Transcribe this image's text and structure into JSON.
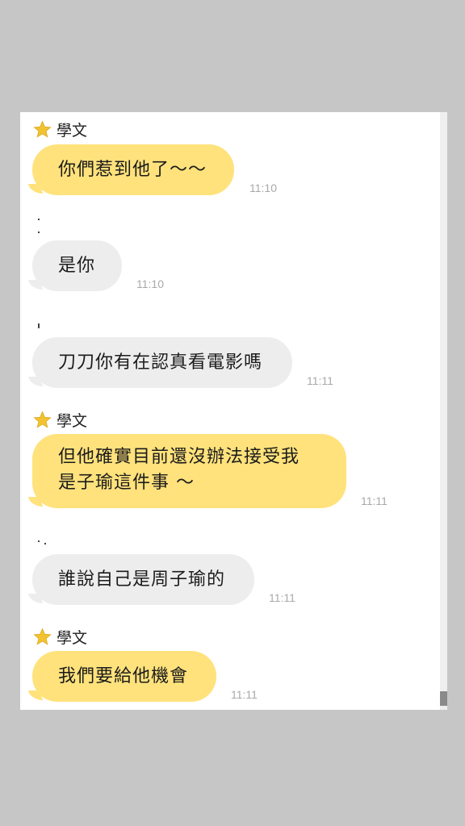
{
  "chat": {
    "messages": [
      {
        "sender": "學文",
        "text": "你們惹到他了～～",
        "time": "11:10"
      },
      {
        "text": "是你",
        "time": "11:10"
      },
      {
        "text": "刀刀你有在認真看電影嗎",
        "time": "11:11"
      },
      {
        "sender": "學文",
        "lines": [
          "但他確實目前還沒辦法接受我",
          "是子瑜這件事 ～"
        ],
        "time": "11:11"
      },
      {
        "text": "誰說自己是周子瑜的",
        "time": "11:11"
      },
      {
        "sender": "學文",
        "text": "我們要給他機會",
        "time": "11:11"
      }
    ]
  },
  "colors": {
    "background": "#c6c6c6",
    "panel": "#ffffff",
    "incoming_bubble": "#ffe27c",
    "outgoing_bubble": "#ededed",
    "timestamp": "#a9a9a9",
    "star": "#f2c230"
  },
  "icons": {
    "sender_badge": "star-icon"
  }
}
